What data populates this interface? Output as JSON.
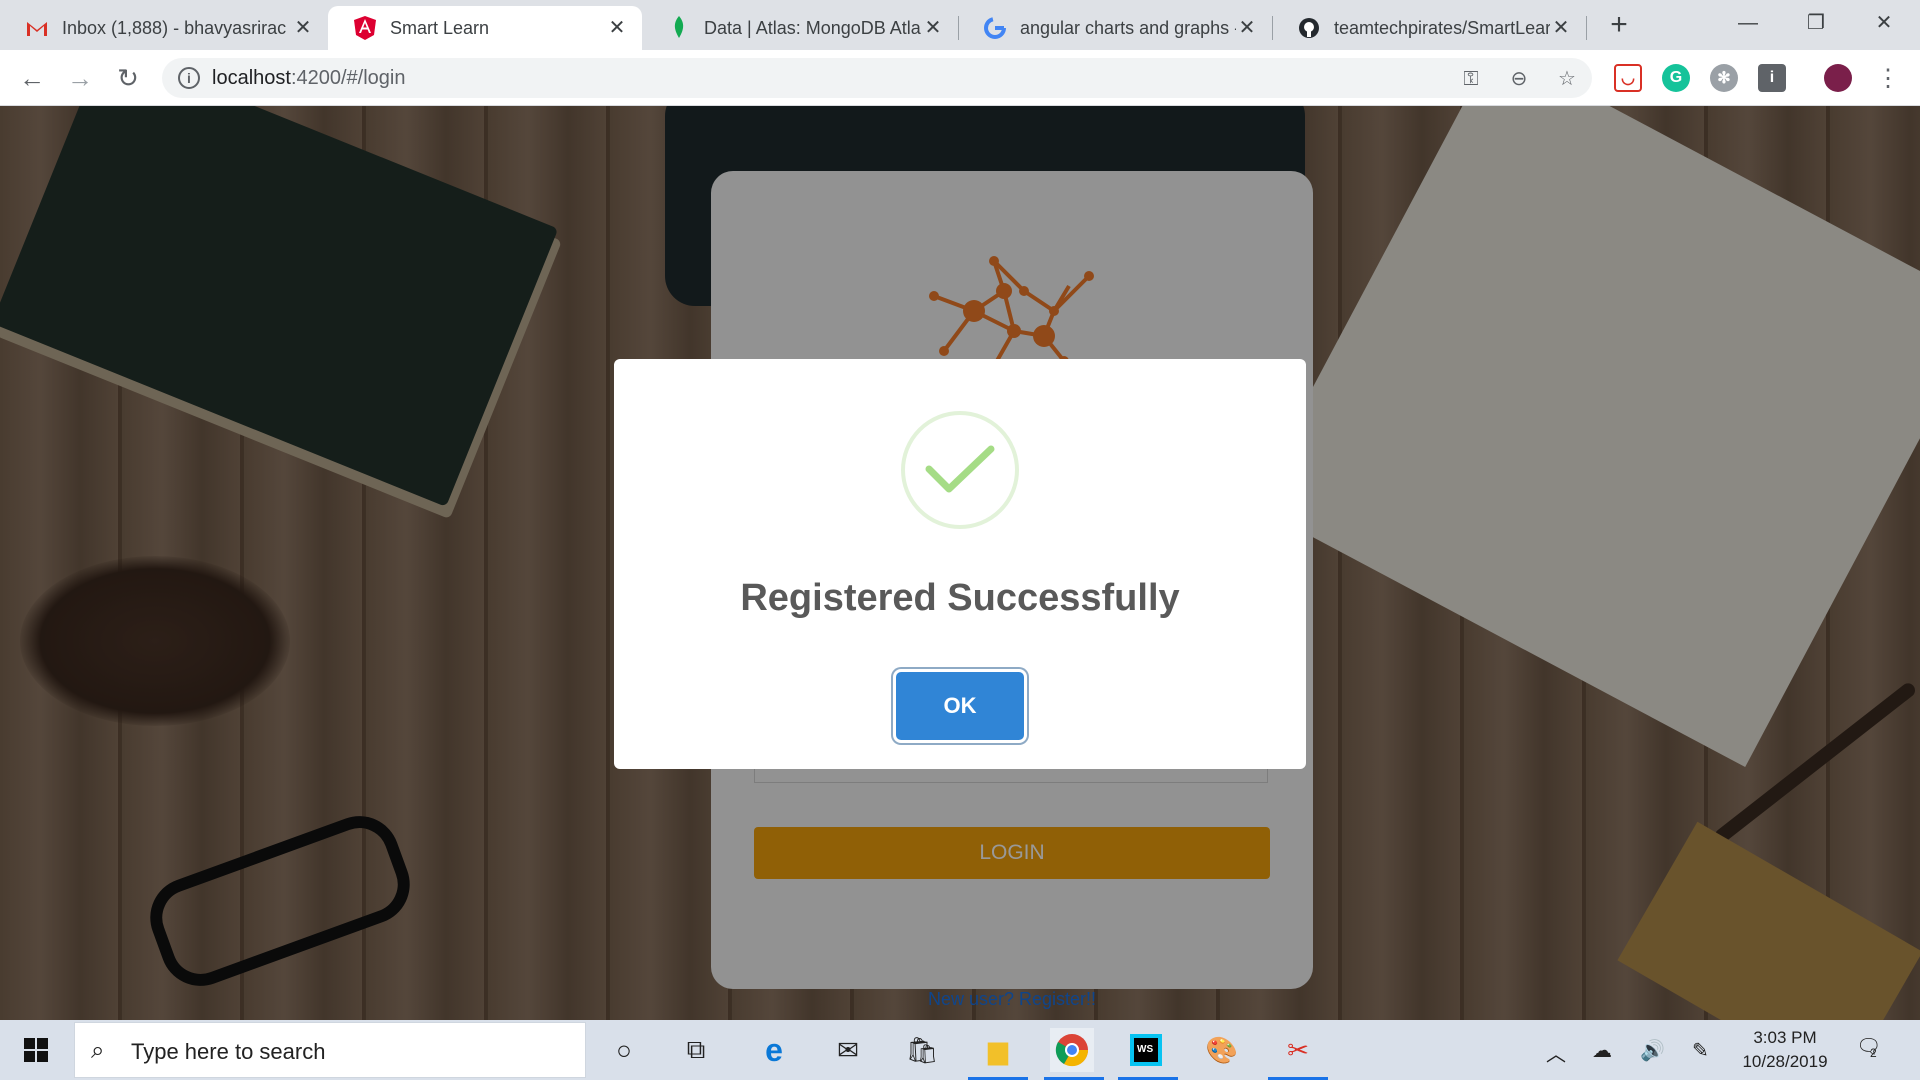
{
  "browser": {
    "tabs": [
      {
        "title": "Inbox (1,888) - bhavyasrirac",
        "icon": "gmail-icon",
        "active": false
      },
      {
        "title": "Smart Learn",
        "icon": "angular-icon",
        "active": true
      },
      {
        "title": "Data | Atlas: MongoDB Atla",
        "icon": "mongodb-leaf-icon",
        "active": false
      },
      {
        "title": "angular charts and graphs -",
        "icon": "google-icon",
        "active": false
      },
      {
        "title": "teamtechpirates/SmartLear",
        "icon": "github-icon",
        "active": false
      }
    ],
    "new_tab_label": "+",
    "url_host": "localhost",
    "url_rest": ":4200/#/login"
  },
  "page": {
    "login_button": "LOGIN",
    "register_link": "New user? Register!!"
  },
  "modal": {
    "title": "Registered Successfully",
    "ok_label": "OK"
  },
  "taskbar": {
    "search_placeholder": "Type here to search",
    "time": "3:03 PM",
    "date": "10/28/2019",
    "notification_count": "2"
  },
  "colors": {
    "accent": "#3085d6",
    "login_button": "#f0a10b",
    "success": "#a5dc86",
    "logo": "#f07b2b"
  }
}
